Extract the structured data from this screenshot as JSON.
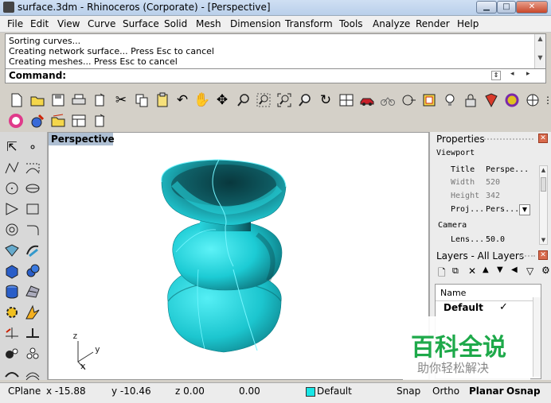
{
  "window": {
    "title": "surface.3dm - Rhinoceros (Corporate) - [Perspective]"
  },
  "menu": [
    "File",
    "Edit",
    "View",
    "Curve",
    "Surface",
    "Solid",
    "Mesh",
    "Dimension",
    "Transform",
    "Tools",
    "Analyze",
    "Render",
    "Help"
  ],
  "command_history": [
    "Sorting curves...",
    "Creating network surface... Press Esc to cancel",
    "Creating meshes... Press Esc to cancel"
  ],
  "command_prompt": "Command:",
  "viewport": {
    "tab_label": "Perspective",
    "axis_labels": {
      "z": "z",
      "y": "y",
      "x": "x"
    }
  },
  "properties": {
    "title": "Properties",
    "section_viewport": "Viewport",
    "rows": [
      {
        "label": "Title",
        "value": "Perspe..."
      },
      {
        "label": "Width",
        "value": "520"
      },
      {
        "label": "Height",
        "value": "342"
      },
      {
        "label": "Proj...",
        "value": "Pers..."
      }
    ],
    "section_camera": "Camera",
    "lens": {
      "label": "Lens...",
      "value": "50.0"
    }
  },
  "layers": {
    "title": "Layers - All Layers",
    "column_name": "Name",
    "rows": [
      {
        "name": "Default",
        "current": "✓"
      }
    ]
  },
  "status": {
    "cplane": "CPlane",
    "x": "x -15.88",
    "y": "y -10.46",
    "z": "z 0.00",
    "dist": "0.00",
    "layer": "Default",
    "snap": "Snap",
    "ortho": "Ortho",
    "planar": "Planar",
    "osnap": "Osnap"
  },
  "watermark": {
    "main": "百科全说",
    "sub": "助你轻松解决"
  },
  "colors": {
    "surface": "#1ecfd8",
    "surface_dark": "#0a5056",
    "edge": "#6ff4ff",
    "layer_swatch": "#19e6e6",
    "title_grad": "#c6d8ef"
  },
  "icons": {
    "toolbar_main": [
      "new-file-icon",
      "open-folder-icon",
      "save-icon",
      "print-icon",
      "new-document-icon",
      "cut-icon",
      "copy-icon",
      "paste-icon",
      "undo-icon",
      "pan-hand-icon",
      "rotate-view-icon",
      "zoom-icon",
      "zoom-window-icon",
      "zoom-extents-icon",
      "zoom-selected-icon",
      "redo-view-icon",
      "viewport-layout-icon",
      "car-icon",
      "bike-icon",
      "osnap-icon",
      "grid-snap-icon",
      "light-bulb-icon",
      "lock-icon",
      "material-icon",
      "render-sphere-icon",
      "shaded-sphere-icon"
    ],
    "toolbar_second": [
      "color-wheel-icon",
      "paint-icon",
      "folder-open-icon",
      "layout-icon",
      "document-icon"
    ],
    "side_toolbar": [
      "select-arrow-icon",
      "point-icon",
      "polyline-icon",
      "curve-control-icon",
      "circle-icon",
      "ellipse-icon",
      "polygon-icon",
      "rectangle-icon",
      "arc-icon",
      "fillet-icon",
      "surface-icon",
      "patch-icon",
      "solid-box-icon",
      "solid-sphere-icon",
      "cylinder-icon",
      "mesh-icon",
      "gear-transform-icon",
      "explode-icon",
      "trim-icon",
      "split-icon",
      "group-icon",
      "array-icon",
      "join-icon",
      "offset-icon"
    ]
  }
}
